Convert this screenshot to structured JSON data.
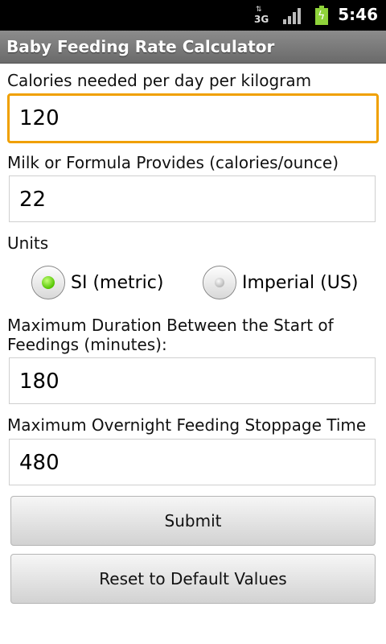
{
  "status_bar": {
    "network_type": "3G",
    "time": "5:46"
  },
  "app": {
    "title": "Baby Feeding Rate Calculator"
  },
  "form": {
    "calories_label": "Calories needed per day per kilogram",
    "calories_value": "120",
    "milk_label": "Milk or Formula Provides (calories/ounce)",
    "milk_value": "22",
    "units_label": "Units",
    "units_options": [
      {
        "label": "SI (metric)",
        "selected": true
      },
      {
        "label": "Imperial (US)",
        "selected": false
      }
    ],
    "duration_label_line1": "Maximum Duration Between the Start of",
    "duration_label_line2": "Feedings (minutes):",
    "duration_value": "180",
    "overnight_label": "Maximum Overnight Feeding Stoppage Time",
    "overnight_value": "480",
    "submit_label": "Submit",
    "reset_label": "Reset to Default Values"
  }
}
